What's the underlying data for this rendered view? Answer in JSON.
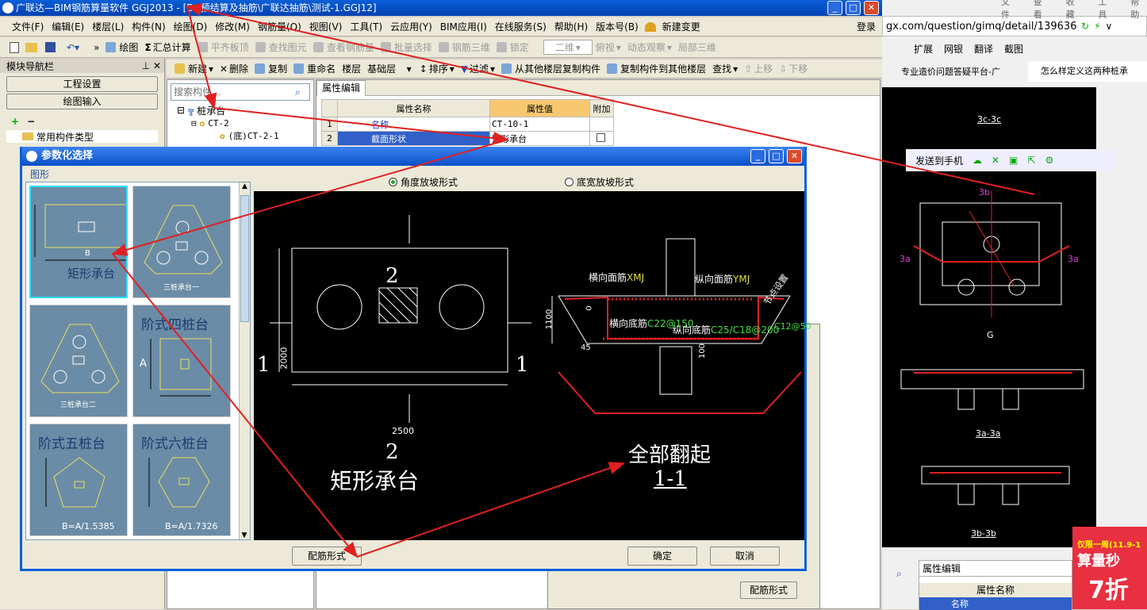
{
  "app": {
    "title": "广联达—BIM钢筋算量软件 GGJ2013 - [D:\\预结算及抽筋\\广联达抽筋\\测试-1.GGJ12]",
    "menu": [
      "文件(F)",
      "编辑(E)",
      "楼层(L)",
      "构件(N)",
      "绘图(D)",
      "修改(M)",
      "钢筋量(Q)",
      "视图(V)",
      "工具(T)",
      "云应用(Y)",
      "BIM应用(I)",
      "在线服务(S)",
      "帮助(H)",
      "版本号(B)",
      "新建变更"
    ],
    "login": "登录",
    "toolbar1": {
      "draw": "绘图",
      "sum": "汇总计算",
      "flat": "平齐板顶",
      "find_elem": "查找图元",
      "view_rebar": "查看钢筋量",
      "batch": "批量选择",
      "rebar3d": "钢筋三维",
      "lock": "锁定",
      "view2d": "二维",
      "top_view": "俯视",
      "dyn": "动态观察",
      "local3d": "局部三维"
    },
    "toolbar2": {
      "new": "新建",
      "delete": "删除",
      "copy": "复制",
      "rename": "重命名",
      "floor_label": "楼层",
      "floor_value": "基础层",
      "sort": "排序",
      "filter": "过滤",
      "copy_from": "从其他楼层复制构件",
      "copy_to": "复制构件到其他楼层",
      "find": "查找",
      "up": "上移",
      "down": "下移"
    },
    "nav": {
      "title": "模块导航栏",
      "proj": "工程设置",
      "draw_input": "绘图输入",
      "common": "常用构件类型"
    },
    "search_placeholder": "搜索构件...",
    "tree": {
      "root": "桩承台",
      "child": "CT-2",
      "leaf": "(底)CT-2-1"
    },
    "props": {
      "tab": "属性编辑",
      "col_name": "属性名称",
      "col_value": "属性值",
      "col_extra": "附加",
      "rows": [
        {
          "no": "1",
          "name": "名称",
          "value": "CT-10-1"
        },
        {
          "no": "2",
          "name": "截面形状",
          "value": "矩形承台"
        }
      ]
    },
    "behind_button": "配筋形式"
  },
  "dialog": {
    "title": "参数化选择",
    "group": "图形",
    "thumbs": [
      {
        "label": "矩形承台",
        "dim": "B"
      },
      {
        "label": "三桩承台一"
      },
      {
        "label": "三桩承台二"
      },
      {
        "label": "阶式四桩台",
        "dim": "A"
      },
      {
        "label": "阶式五桩台",
        "formula": "B=A/1.5385"
      },
      {
        "label": "阶式六桩台",
        "formula": "B=A/1.7326"
      }
    ],
    "radio_angle": "角度放坡形式",
    "radio_width": "底宽放坡形式",
    "cad": {
      "sec_top": "2",
      "sec_bottom": "2",
      "sec_left": "1",
      "sec_right": "1",
      "width": "2500",
      "height": "2000",
      "shape_name": "矩形承台",
      "h_top": "横向面筋",
      "h_top_code": "XMJ",
      "v_top": "纵向面筋",
      "v_top_code": "YMJ",
      "h_bot": "横向底筋",
      "h_bot_code": "C22@150",
      "v_bot": "纵向底筋",
      "v_bot_code": "C25/C18@200",
      "extra_code": "C12@50",
      "node": "节点设置",
      "dim_1100": "1100",
      "dim_0": "0",
      "dim_45": "45",
      "dim_100": "100",
      "caption1": "全部翻起",
      "caption2": "1-1"
    },
    "btn_rebar": "配筋形式",
    "btn_ok": "确定",
    "btn_cancel": "取消"
  },
  "browser": {
    "url": "gx.com/question/gimq/detail/139636",
    "menu": [
      "文件",
      "查看",
      "收藏",
      "工具",
      "帮助"
    ],
    "bookmarks": [
      "扩展",
      "网银",
      "翻译",
      "截图"
    ],
    "tabs": [
      "专业造价问题答疑平台-广",
      "怎么样定义这两种桩承"
    ],
    "send": "发送到手机",
    "labels": {
      "sec_3c": "3c-3c",
      "sec_3a": "3a-3a",
      "sec_3b": "3b-3b",
      "g": "G",
      "3a_left": "3a",
      "3a_right": "3a",
      "3b": "3b"
    },
    "props_tab": "属性编辑",
    "props_col": "属性名称",
    "props_row": "名称",
    "ad1": "仅限一周(11.9-1",
    "ad2": "算量秒",
    "ad3": "7折"
  }
}
